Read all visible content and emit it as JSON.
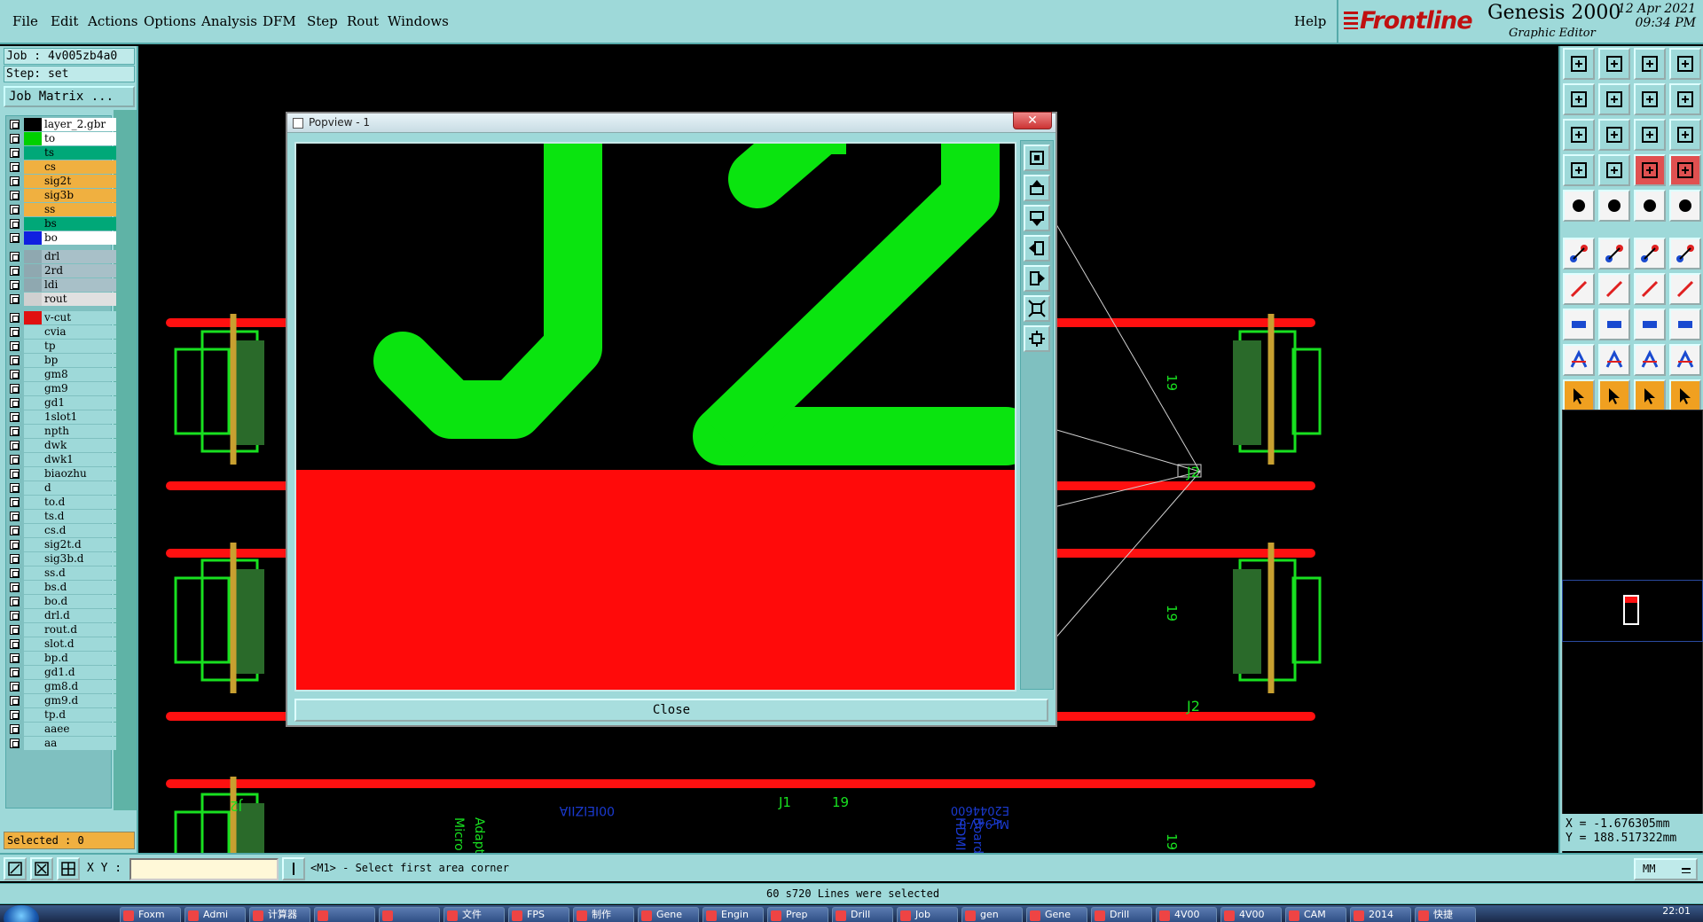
{
  "menubar": {
    "items": [
      "File",
      "Edit",
      "Actions",
      "Options",
      "Analysis",
      "DFM",
      "Step",
      "Rout",
      "Windows"
    ],
    "help": "Help"
  },
  "brand": {
    "logo": "Frontline",
    "product": "Genesis 2000",
    "subtitle": "Graphic Editor",
    "date": "12 Apr 2021",
    "time": "09:34 PM"
  },
  "left": {
    "job": "Job : 4v005zb4a0",
    "step": "Step: set",
    "job_matrix": "Job Matrix ...",
    "selected": "Selected : 0",
    "layers": [
      {
        "name": "layer_2.gbr",
        "swatch": "#000000",
        "bg": "#ffffff"
      },
      {
        "name": "to",
        "swatch": "#00d000",
        "bg": "#ffffff"
      },
      {
        "name": "ts",
        "swatch": "#00a878",
        "bg": "#00a878"
      },
      {
        "name": "cs",
        "swatch": "#f0b040",
        "bg": "#f0b040"
      },
      {
        "name": "sig2t",
        "swatch": "#f0b040",
        "bg": "#f0b040"
      },
      {
        "name": "sig3b",
        "swatch": "#f0b040",
        "bg": "#f0b040"
      },
      {
        "name": "ss",
        "swatch": "#f0b040",
        "bg": "#f0b040"
      },
      {
        "name": "bs",
        "swatch": "#00a878",
        "bg": "#00a878"
      },
      {
        "name": "bo",
        "swatch": "#1020e0",
        "bg": "#ffffff"
      },
      {
        "name": "drl",
        "swatch": "#8fa8b0",
        "bg": "#a8c0c8"
      },
      {
        "name": "2rd",
        "swatch": "#8fa8b0",
        "bg": "#a8c0c8"
      },
      {
        "name": "ldi",
        "swatch": "#8fa8b0",
        "bg": "#a8c0c8"
      },
      {
        "name": "rout",
        "swatch": "#d0d0d0",
        "bg": "#e0e0e0"
      },
      {
        "name": "v-cut",
        "swatch": "#e01010",
        "bg": "#9ed9d9"
      },
      {
        "name": "cvia",
        "swatch": "#9ed9d9",
        "bg": "#9ed9d9"
      },
      {
        "name": "tp",
        "swatch": "#9ed9d9",
        "bg": "#9ed9d9"
      },
      {
        "name": "bp",
        "swatch": "#9ed9d9",
        "bg": "#9ed9d9"
      },
      {
        "name": "gm8",
        "swatch": "#9ed9d9",
        "bg": "#9ed9d9"
      },
      {
        "name": "gm9",
        "swatch": "#9ed9d9",
        "bg": "#9ed9d9"
      },
      {
        "name": "gd1",
        "swatch": "#9ed9d9",
        "bg": "#9ed9d9"
      },
      {
        "name": "1slot1",
        "swatch": "#9ed9d9",
        "bg": "#9ed9d9"
      },
      {
        "name": "npth",
        "swatch": "#9ed9d9",
        "bg": "#9ed9d9"
      },
      {
        "name": "dwk",
        "swatch": "#9ed9d9",
        "bg": "#9ed9d9"
      },
      {
        "name": "dwk1",
        "swatch": "#9ed9d9",
        "bg": "#9ed9d9"
      },
      {
        "name": "biaozhu",
        "swatch": "#9ed9d9",
        "bg": "#9ed9d9"
      },
      {
        "name": "d",
        "swatch": "#9ed9d9",
        "bg": "#9ed9d9"
      },
      {
        "name": "to.d",
        "swatch": "#9ed9d9",
        "bg": "#9ed9d9"
      },
      {
        "name": "ts.d",
        "swatch": "#9ed9d9",
        "bg": "#9ed9d9"
      },
      {
        "name": "cs.d",
        "swatch": "#9ed9d9",
        "bg": "#9ed9d9"
      },
      {
        "name": "sig2t.d",
        "swatch": "#9ed9d9",
        "bg": "#9ed9d9"
      },
      {
        "name": "sig3b.d",
        "swatch": "#9ed9d9",
        "bg": "#9ed9d9"
      },
      {
        "name": "ss.d",
        "swatch": "#9ed9d9",
        "bg": "#9ed9d9"
      },
      {
        "name": "bs.d",
        "swatch": "#9ed9d9",
        "bg": "#9ed9d9"
      },
      {
        "name": "bo.d",
        "swatch": "#9ed9d9",
        "bg": "#9ed9d9"
      },
      {
        "name": "drl.d",
        "swatch": "#9ed9d9",
        "bg": "#9ed9d9"
      },
      {
        "name": "rout.d",
        "swatch": "#9ed9d9",
        "bg": "#9ed9d9"
      },
      {
        "name": "slot.d",
        "swatch": "#9ed9d9",
        "bg": "#9ed9d9"
      },
      {
        "name": "bp.d",
        "swatch": "#9ed9d9",
        "bg": "#9ed9d9"
      },
      {
        "name": "gd1.d",
        "swatch": "#9ed9d9",
        "bg": "#9ed9d9"
      },
      {
        "name": "gm8.d",
        "swatch": "#9ed9d9",
        "bg": "#9ed9d9"
      },
      {
        "name": "gm9.d",
        "swatch": "#9ed9d9",
        "bg": "#9ed9d9"
      },
      {
        "name": "tp.d",
        "swatch": "#9ed9d9",
        "bg": "#9ed9d9"
      },
      {
        "name": "aaee",
        "swatch": "#9ed9d9",
        "bg": "#9ed9d9"
      },
      {
        "name": "aa",
        "swatch": "#9ed9d9",
        "bg": "#9ed9d9"
      }
    ]
  },
  "canvas": {
    "labels": [
      "J2",
      "J2",
      "J2",
      "J2",
      "J1",
      "19",
      "19",
      "19",
      "19",
      "J1",
      "00IEIZIIA",
      "E2044600",
      "MI 94V-0",
      "Micro",
      "Adapt",
      "HDMI",
      "Board",
      "A"
    ],
    "colors": {
      "copper": "#18e020",
      "vcut": "#ff1010",
      "pad": "#2a6a2a",
      "silk_blue": "#1a3ad0",
      "outline": "#d0d0d0"
    }
  },
  "popview": {
    "title": "Popview - 1",
    "close": "Close",
    "zoom_text": "J2"
  },
  "right": {
    "coord_x": "X = -1.676305mm",
    "coord_y": "Y = 188.517322mm"
  },
  "bottom": {
    "xy_label": "X Y :",
    "xy_value": "",
    "prompt": "<M1> - Select first area corner",
    "units": "MM",
    "status": "60 s720 Lines were selected"
  },
  "taskbar": {
    "items": [
      "Foxm",
      "Admi",
      "计算器",
      "",
      "",
      "文件",
      "FPS",
      "制作",
      "Gene",
      "Engin",
      "Prep",
      "Drill",
      "Job",
      "gen",
      "Gene",
      "Drill",
      "4V00",
      "4V00",
      "CAM",
      "2014",
      "快捷"
    ],
    "clock": "22:01"
  }
}
